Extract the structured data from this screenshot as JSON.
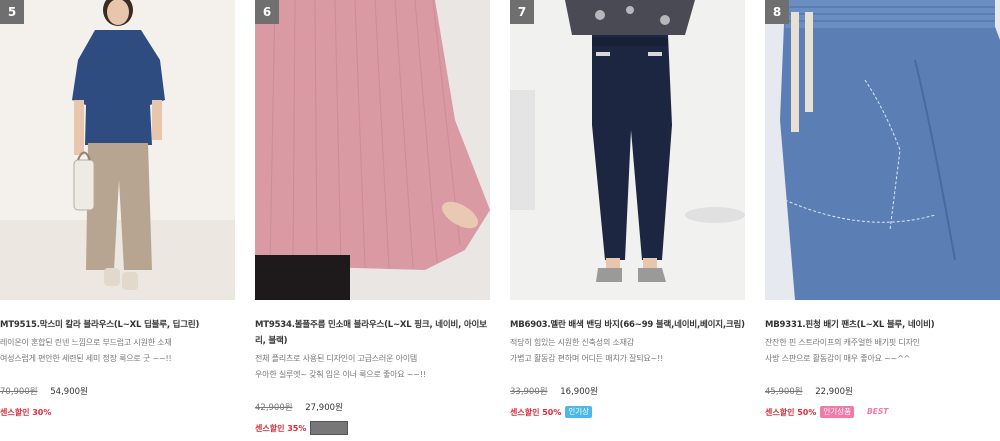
{
  "products": [
    {
      "rank": "5",
      "name": "MT9515.막스미 칼라 블라우스(L~XL 딥블루, 딥그린)",
      "desc": [
        "레이온이 혼합된 린넨 느낌으로 부드럽고 시원한 소재",
        "여성스럽게 편안한 세련된 세미 정장 룩으로 굿 ~~!!"
      ],
      "old_price": "70,900원",
      "price": "54,900원",
      "sale": "센스할인 30%"
    },
    {
      "rank": "6",
      "name": "MT9534.볼플주름 민소매 블라우스(L~XL 핑크, 네이비, 아이보리, 블랙)",
      "desc": [
        "전체 플리츠로 사용된 디자인이 고급스러운 아이템",
        "우아한 실루엣~ 갖춰 입은 이너 룩으로 좋아요 ~~!!"
      ],
      "old_price": "42,900원",
      "price": "27,900원",
      "sale": "센스할인 35%"
    },
    {
      "rank": "7",
      "name": "MB6903.멜란 배색 밴딩 바지(66~99 블랙,네이비,베이지,크림)",
      "desc": [
        "적당히 힘있는 시원한 신축성의 소재감",
        "가볍고 활동감 편하며 어디든 매치가 잘되요~!!"
      ],
      "old_price": "33,900원",
      "price": "16,900원",
      "sale": "센스할인 50%",
      "badge": "인기상"
    },
    {
      "rank": "8",
      "name": "MB9331.핀청 배기 팬츠(L~XL 블루, 네이비)",
      "desc": [
        "잔잔한 핀 스트라이프의 캐주얼한 배기핏 디자인",
        "사방 스판으로 활동감이 매우 좋아요 ~~^^"
      ],
      "old_price": "45,900원",
      "price": "22,900원",
      "sale": "센스할인 50%",
      "badge": "인기상품",
      "badge2": "BEST"
    }
  ]
}
